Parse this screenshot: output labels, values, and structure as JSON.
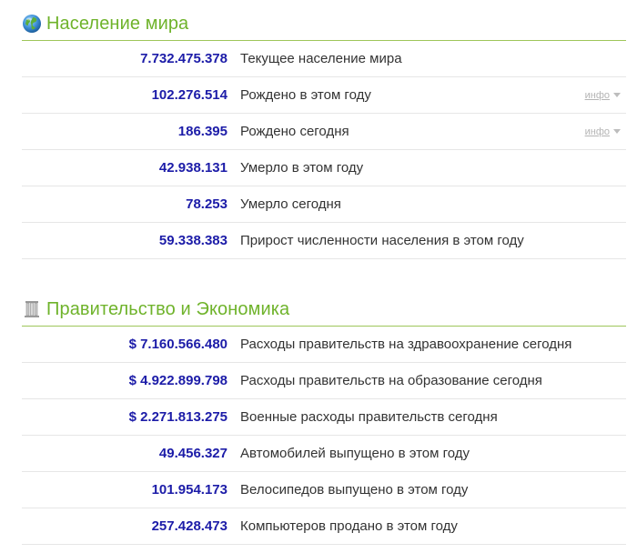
{
  "population": {
    "icon": "globe-icon",
    "title": "Население мира",
    "rows": [
      {
        "value": "7.732.475.378",
        "label": "Текущее население мира",
        "info": ""
      },
      {
        "value": "102.276.514",
        "label": "Рождено в этом году",
        "info": "инфо"
      },
      {
        "value": "186.395",
        "label": "Рождено сегодня",
        "info": "инфо"
      },
      {
        "value": "42.938.131",
        "label": "Умерло в этом году",
        "info": ""
      },
      {
        "value": "78.253",
        "label": "Умерло сегодня",
        "info": ""
      },
      {
        "value": "59.338.383",
        "label": "Прирост численности населения в этом году",
        "info": ""
      }
    ]
  },
  "government": {
    "icon": "columns-icon",
    "title": "Правительство и Экономика",
    "rows": [
      {
        "value": "$ 7.160.566.480",
        "label": "Расходы правительств на здравоохранение сегодня"
      },
      {
        "value": "$ 4.922.899.798",
        "label": "Расходы правительств на образование сегодня"
      },
      {
        "value": "$ 2.271.813.275",
        "label": "Военные расходы правительств сегодня"
      },
      {
        "value": "49.456.327",
        "label": "Автомобилей выпущено в этом году"
      },
      {
        "value": "101.954.173",
        "label": "Велосипедов выпущено в этом году"
      },
      {
        "value": "257.428.473",
        "label": "Компьютеров продано в этом году"
      }
    ]
  },
  "colors": {
    "title_green": "#6fb32b",
    "value_blue": "#1c1ca8",
    "divider": "#e6e6e6",
    "header_rule": "#9ec65a"
  }
}
